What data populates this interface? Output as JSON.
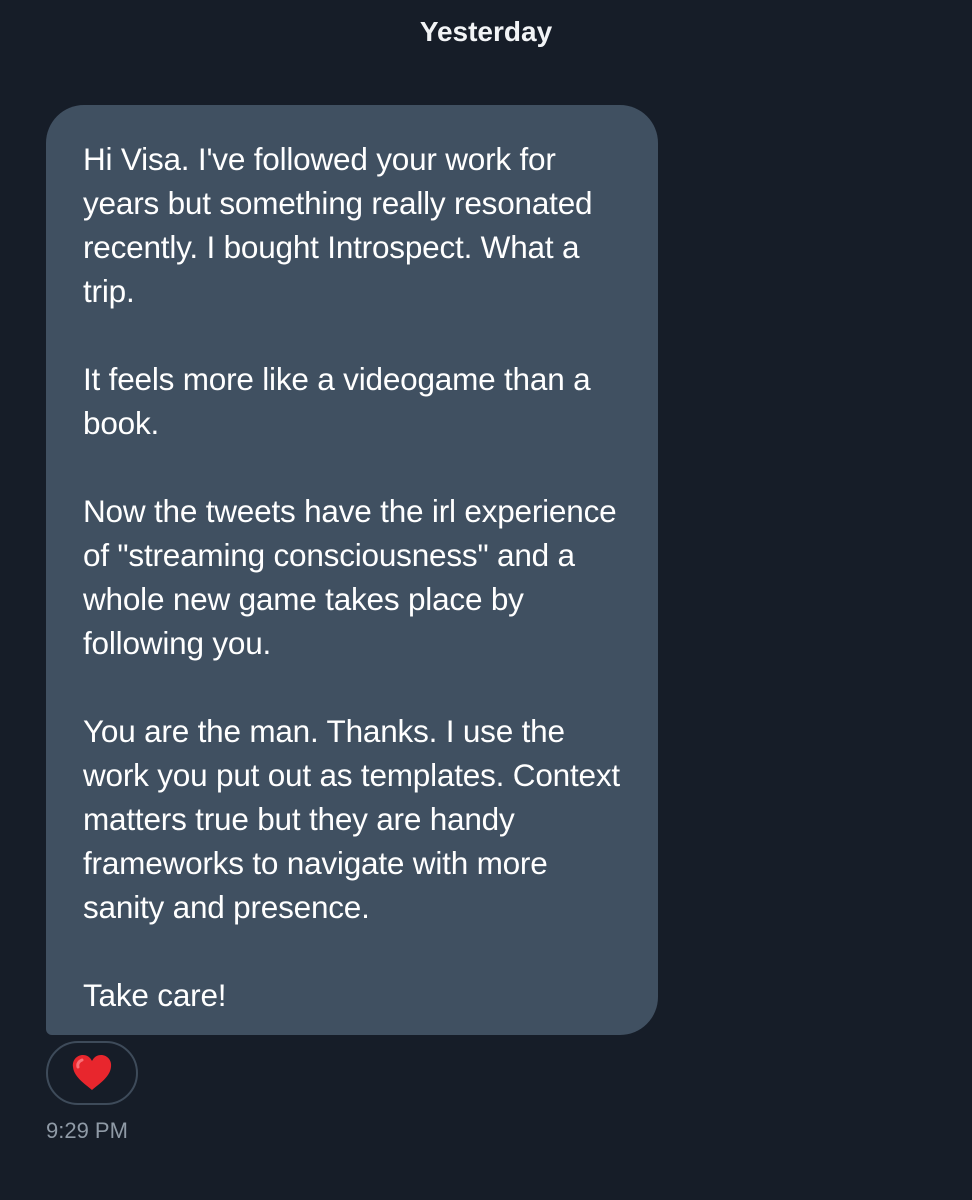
{
  "conversation": {
    "date_divider": "Yesterday",
    "message": {
      "paragraphs": [
        "Hi Visa. I've followed your work for years but something really resonated recently. I bought Introspect. What a trip.",
        "It feels more like a videogame than a book.",
        "Now the tweets have the irl experience of \"streaming consciousness\" and a whole new game takes place by following you.",
        "You are the man. Thanks. I use the work you put out as templates. Context matters true but they are handy frameworks to navigate with more sanity and presence.",
        "Take care!"
      ],
      "reaction": {
        "icon": "red-heart-icon",
        "color": "#e8262d"
      },
      "timestamp": "9:29 PM"
    },
    "colors": {
      "background": "#161d28",
      "bubble": "#405061",
      "timestamp": "#8f9aa6"
    }
  }
}
